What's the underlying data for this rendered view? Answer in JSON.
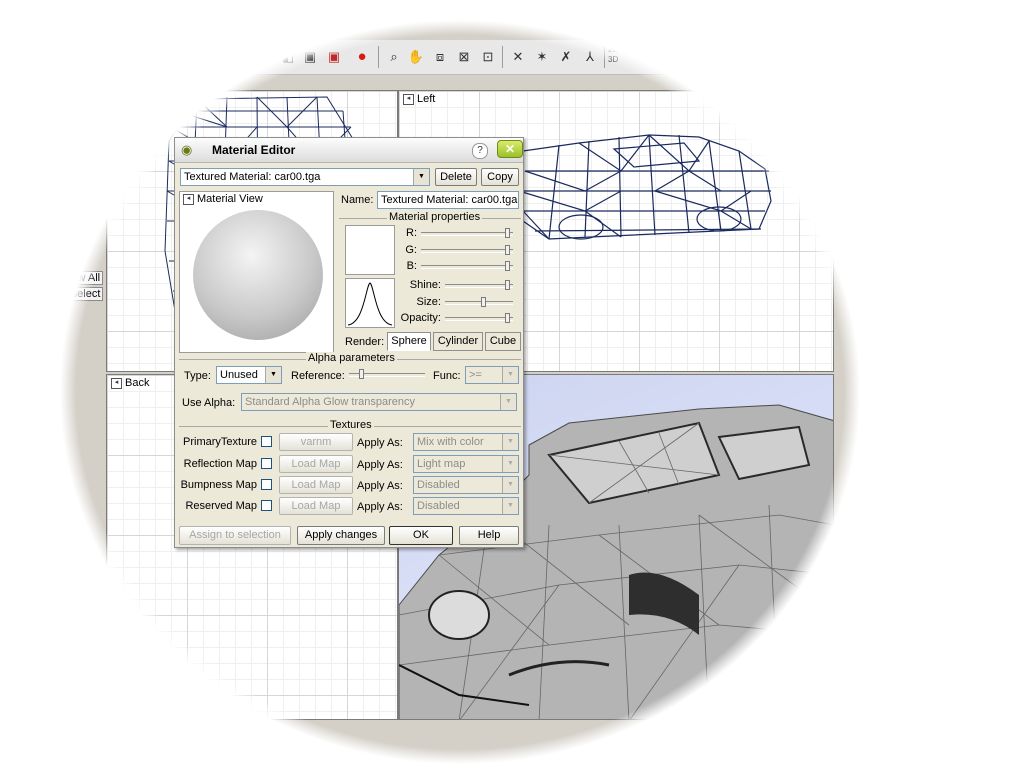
{
  "app": {
    "toolbar": {
      "icons": [
        "box-outline-icon",
        "box-solid-icon",
        "box-wire-icon",
        "box-red-icon",
        "material-sphere-icon",
        "zoom-icon",
        "hand-icon",
        "cube-icon",
        "render-icon",
        "camera-icon",
        "vertex-select-icon",
        "star-select-icon",
        "edge-select-icon",
        "axis-icon"
      ],
      "mode_toggle": "2D",
      "mode_toggle_2": "3D"
    },
    "viewports": {
      "left_label": "Left",
      "back_label": "Back"
    },
    "side_buttons": {
      "show_all": "Show All",
      "deselect": "Deselect"
    }
  },
  "dialog": {
    "title": "Material Editor",
    "material_select": "Textured Material: car00.tga",
    "delete_label": "Delete",
    "copy_label": "Copy",
    "material_view_label": "Material View",
    "name_label": "Name:",
    "name_value": "Textured Material: car00.tga",
    "properties": {
      "title": "Material properties",
      "r_label": "R:",
      "g_label": "G:",
      "b_label": "B:",
      "shine_label": "Shine:",
      "size_label": "Size:",
      "opacity_label": "Opacity:"
    },
    "render": {
      "label": "Render:",
      "tabs": [
        "Sphere",
        "Cylinder",
        "Cube"
      ],
      "active": "Sphere"
    },
    "alpha": {
      "title": "Alpha parameters",
      "type_label": "Type:",
      "type_value": "Unused",
      "reference_label": "Reference:",
      "func_label": "Func:",
      "func_value": ">=",
      "use_alpha_label": "Use Alpha:",
      "use_alpha_value": "Standard Alpha Glow transparency"
    },
    "textures": {
      "title": "Textures",
      "apply_as_label": "Apply As:",
      "rows": [
        {
          "label": "PrimaryTexture",
          "button": "varnm",
          "apply": "Mix with color"
        },
        {
          "label": "Reflection Map",
          "button": "Load Map",
          "apply": "Light map"
        },
        {
          "label": "Bumpness Map",
          "button": "Load Map",
          "apply": "Disabled"
        },
        {
          "label": "Reserved Map",
          "button": "Load Map",
          "apply": "Disabled"
        }
      ]
    },
    "footer": {
      "assign": "Assign to selection",
      "apply": "Apply changes",
      "ok": "OK",
      "help": "Help"
    }
  },
  "colors": {
    "title_accent": "#9cc02a",
    "wire_blue": "#1b2a5e",
    "perspective_bg": "#cdd4f0",
    "dialog_bg": "#ece9d8"
  }
}
